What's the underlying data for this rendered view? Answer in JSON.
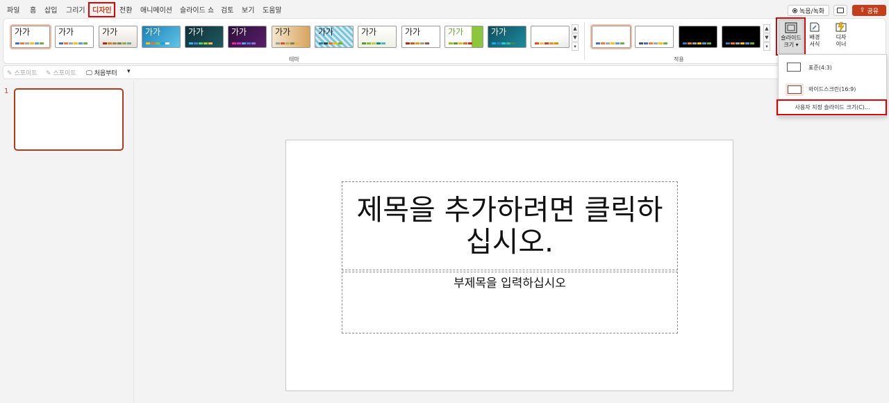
{
  "menu": {
    "tabs": [
      {
        "label": "파일"
      },
      {
        "label": "홈"
      },
      {
        "label": "삽입"
      },
      {
        "label": "그리기"
      },
      {
        "label": "디자인"
      },
      {
        "label": "전환"
      },
      {
        "label": "애니메이션"
      },
      {
        "label": "슬라이드 쇼"
      },
      {
        "label": "검토"
      },
      {
        "label": "보기"
      },
      {
        "label": "도움말"
      }
    ],
    "active_tab": "디자인",
    "record_label": "녹음/녹화",
    "share_label": "공유"
  },
  "ribbon": {
    "theme_sample_text": "가가",
    "themes_group_label": "테마",
    "variants_group_label": "적용",
    "slide_size_label": "슬라이드 크기",
    "slide_size_line1": "슬라이드",
    "slide_size_line2": "크기 ▾",
    "background_line1": "배경",
    "background_line2": "서식",
    "designer_line1": "디자",
    "designer_line2": "이너"
  },
  "quick": {
    "eyedropper1": "스포이트",
    "eyedropper2": "스포이트",
    "from_beginning": "처음부터"
  },
  "slides": {
    "current_number": "1"
  },
  "slide": {
    "title_placeholder": "제목을 추가하려면 클릭하십시오.",
    "subtitle_placeholder": "부제목을 입력하십시오"
  },
  "dropdown": {
    "standard": "표준(4:3)",
    "widescreen": "와이드스크린(16:9)",
    "custom": "사용자 지정 슬라이드 크기(C)..."
  },
  "colors": {
    "accent": "#c43e1c",
    "highlight": "#e00000"
  }
}
